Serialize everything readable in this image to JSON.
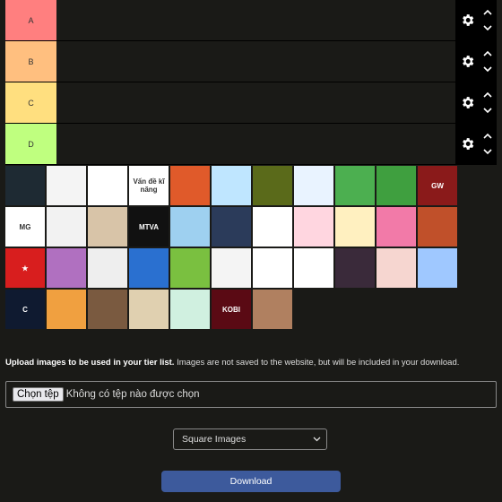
{
  "tiers": [
    {
      "label": "A",
      "color": "#ff7f7f"
    },
    {
      "label": "B",
      "color": "#ffbf7f"
    },
    {
      "label": "C",
      "color": "#ffdf7f"
    },
    {
      "label": "D",
      "color": "#bfff7f"
    }
  ],
  "icons": {
    "settings": "gear-icon",
    "up": "chevron-up-icon",
    "down": "chevron-down-icon"
  },
  "pool_images": [
    {
      "name": "dark-warrior",
      "bg": "#1e2a33",
      "text": ""
    },
    {
      "name": "cartoon-drawing",
      "bg": "#f4f4f4",
      "text": ""
    },
    {
      "name": "cat-box",
      "bg": "#ffffff",
      "text": ""
    },
    {
      "name": "van-de-ki-nang",
      "bg": "#ffffff",
      "text": "Vấn đề kĩ năng"
    },
    {
      "name": "white-cat-red",
      "bg": "#e05a2a",
      "text": ""
    },
    {
      "name": "blue-swirl",
      "bg": "#bfe6ff",
      "text": ""
    },
    {
      "name": "yellow-dog",
      "bg": "#5a6a1a",
      "text": ""
    },
    {
      "name": "cat-cloud",
      "bg": "#e9f3ff",
      "text": ""
    },
    {
      "name": "purple-cat-green",
      "bg": "#4caf50",
      "text": ""
    },
    {
      "name": "rainbow-frog",
      "bg": "#3f9f3f",
      "text": ""
    },
    {
      "name": "gw-logo",
      "bg": "#8a1a1a",
      "text": "GW"
    },
    {
      "name": "mg-logo",
      "bg": "#ffffff",
      "text": "MG"
    },
    {
      "name": "anime-sketch",
      "bg": "#f2f2f2",
      "text": ""
    },
    {
      "name": "anime-girls",
      "bg": "#d8c4a8",
      "text": ""
    },
    {
      "name": "mtva-gaming",
      "bg": "#111111",
      "text": "MTVA"
    },
    {
      "name": "anime-boy",
      "bg": "#9ed0f0",
      "text": ""
    },
    {
      "name": "anime-girl-dark",
      "bg": "#2b3b5a",
      "text": ""
    },
    {
      "name": "pixel-cat",
      "bg": "#ffffff",
      "text": ""
    },
    {
      "name": "red-hair-girl",
      "bg": "#ffd6e0",
      "text": ""
    },
    {
      "name": "cat-pattern",
      "bg": "#fff0c0",
      "text": ""
    },
    {
      "name": "pink-cats",
      "bg": "#f27aa8",
      "text": ""
    },
    {
      "name": "pixel-landscape",
      "bg": "#c0502a",
      "text": ""
    },
    {
      "name": "star-flag",
      "bg": "#d81e1e",
      "text": "★"
    },
    {
      "name": "purple-girl",
      "bg": "#b070c0",
      "text": ""
    },
    {
      "name": "chibi-sketch",
      "bg": "#eeeeee",
      "text": ""
    },
    {
      "name": "blue-hair-boy",
      "bg": "#2a70d0",
      "text": ""
    },
    {
      "name": "cat-sticker",
      "bg": "#7ac040",
      "text": ""
    },
    {
      "name": "witch-sketch",
      "bg": "#f4f4f4",
      "text": ""
    },
    {
      "name": "red-hair-sketch",
      "bg": "#ffffff",
      "text": ""
    },
    {
      "name": "bw-chibi",
      "bg": "#ffffff",
      "text": ""
    },
    {
      "name": "dark-girl",
      "bg": "#3a2a3a",
      "text": ""
    },
    {
      "name": "pink-hair-girl",
      "bg": "#f6d6d0",
      "text": ""
    },
    {
      "name": "cat-night",
      "bg": "#9fc8ff",
      "text": ""
    },
    {
      "name": "c-logo",
      "bg": "#0f1a30",
      "text": "C"
    },
    {
      "name": "orange-monster",
      "bg": "#f0a040",
      "text": ""
    },
    {
      "name": "photo-person",
      "bg": "#7a5a40",
      "text": ""
    },
    {
      "name": "twin-chibi",
      "bg": "#e0d0b0",
      "text": ""
    },
    {
      "name": "green-hair-girl",
      "bg": "#d0f0e0",
      "text": ""
    },
    {
      "name": "kobi-logo",
      "bg": "#5a0a14",
      "text": "KOBI"
    },
    {
      "name": "mustache-photo",
      "bg": "#b08060",
      "text": ""
    }
  ],
  "upload": {
    "note_bold": "Upload images to be used in your tier list.",
    "note_rest": " Images are not saved to the website, but will be included in your download.",
    "button_label": "Chọn tệp",
    "no_file_text": "Không có tệp nào được chọn"
  },
  "image_mode": {
    "selected": "Square Images"
  },
  "download": {
    "label": "Download"
  }
}
